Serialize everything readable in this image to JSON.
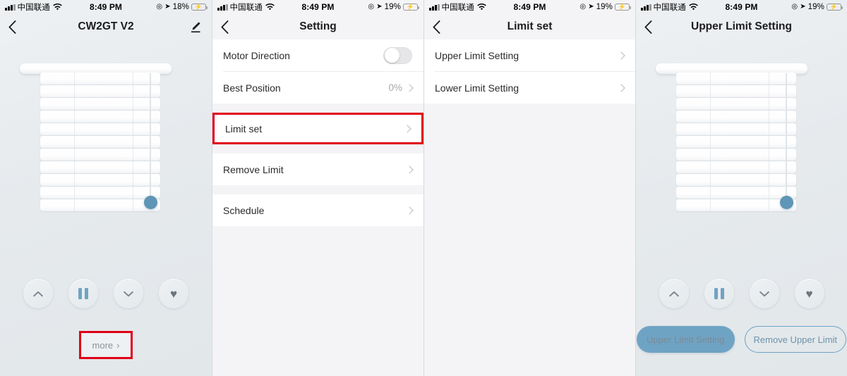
{
  "status_bar": {
    "carrier": "中国联通",
    "time": "8:49 PM",
    "battery_1": "18%",
    "battery_2": "19%",
    "battery_3": "19%",
    "battery_4": "19%",
    "wifi_icon": "wifi-icon",
    "signal_icon": "signal-bars-icon",
    "location_icon": "location-arrow-icon",
    "alarm_icon": "alarm-icon",
    "battery_icon": "battery-charging-icon"
  },
  "colors": {
    "accent_blue": "#6fa3c4",
    "handle_blue": "#5f95b6",
    "highlight_red": "#e00016",
    "list_bg": "#f4f4f6",
    "device_bg": "#e9edef"
  },
  "panel1": {
    "title": "CW2GT V2",
    "back_icon": "back-chevron-icon",
    "edit_icon": "edit-pencil-icon",
    "device_icon": "window-blind-icon",
    "controls": [
      {
        "name": "up-button",
        "icon": "chevron-up-icon"
      },
      {
        "name": "pause-button",
        "icon": "pause-icon"
      },
      {
        "name": "down-button",
        "icon": "chevron-down-icon"
      },
      {
        "name": "favorite-button",
        "icon": "heart-icon"
      }
    ],
    "more_label": "more",
    "more_chevron": "›"
  },
  "panel2": {
    "title": "Setting",
    "back_icon": "back-chevron-icon",
    "rows": [
      {
        "label": "Motor Direction",
        "control": "toggle",
        "toggle_on": false
      },
      {
        "label": "Best Position",
        "value": "0%",
        "control": "chevron"
      },
      {
        "label": "Limit set",
        "control": "chevron",
        "highlighted": true
      },
      {
        "label": "Remove  Limit",
        "control": "chevron"
      },
      {
        "label": "Schedule",
        "control": "chevron"
      }
    ]
  },
  "panel3": {
    "title": "Limit set",
    "back_icon": "back-chevron-icon",
    "rows": [
      {
        "label": "Upper Limit Setting",
        "control": "chevron"
      },
      {
        "label": "Lower Limit Setting",
        "control": "chevron"
      }
    ]
  },
  "panel4": {
    "title": "Upper Limit Setting",
    "back_icon": "back-chevron-icon",
    "device_icon": "window-blind-icon",
    "controls": [
      {
        "name": "up-button",
        "icon": "chevron-up-icon"
      },
      {
        "name": "pause-button",
        "icon": "pause-icon"
      },
      {
        "name": "down-button",
        "icon": "chevron-down-icon"
      },
      {
        "name": "favorite-button",
        "icon": "heart-icon"
      }
    ],
    "primary_button": "Upper Limit Setting",
    "secondary_button": "Remove Upper Limit"
  }
}
